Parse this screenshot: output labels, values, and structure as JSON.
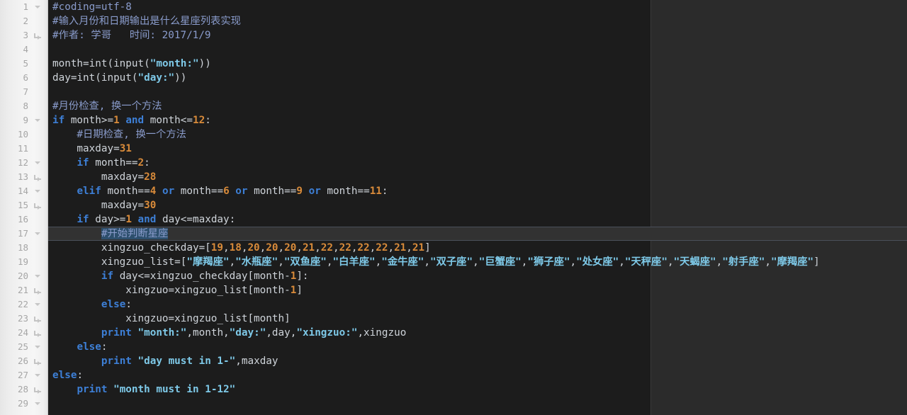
{
  "app": {
    "kind": "code-editor",
    "theme": "dark",
    "language": "Python",
    "colors": {
      "editor_background": "#1c1c1c",
      "panel_background": "#2b2b2b",
      "gutter_background": "#f2f2f2",
      "line_number": "#a6a6a6",
      "default_text": "#a9b7c6",
      "comment": "#8a9ccc",
      "keyword": "#3d7fd6",
      "number": "#d98b3a",
      "string": "#7ec9e8",
      "active_line_background": "#323232",
      "selection": "#2d4f6d"
    },
    "active_line": 17,
    "total_visible_lines": 29
  },
  "gutter": {
    "line_numbers": [
      "1",
      "2",
      "3",
      "4",
      "5",
      "6",
      "7",
      "8",
      "9",
      "10",
      "11",
      "12",
      "13",
      "14",
      "15",
      "16",
      "17",
      "18",
      "19",
      "20",
      "21",
      "22",
      "23",
      "24",
      "25",
      "26",
      "27",
      "28",
      "29"
    ],
    "markers": {
      "fold_icon": "chevron-down-icon",
      "continuation_icon": "line-continuation-icon",
      "fold_lines": [
        1,
        9,
        12,
        14,
        17,
        20,
        22,
        25,
        27,
        29
      ],
      "continuation_lines": [
        3,
        13,
        15,
        21,
        23,
        24,
        26,
        28
      ]
    }
  },
  "code": {
    "lines": [
      {
        "n": 1,
        "tokens": [
          {
            "t": "com",
            "v": "#coding=utf-8"
          }
        ]
      },
      {
        "n": 2,
        "tokens": [
          {
            "t": "com",
            "v": "#输入月份和日期输出是什么星座列表实现"
          }
        ]
      },
      {
        "n": 3,
        "tokens": [
          {
            "t": "com",
            "v": "#作者: 学哥   时间: 2017/1/9"
          }
        ]
      },
      {
        "n": 4,
        "tokens": []
      },
      {
        "n": 5,
        "tokens": [
          {
            "t": "pl",
            "v": "month=int(input("
          },
          {
            "t": "str",
            "v": "\"month:\""
          },
          {
            "t": "pl",
            "v": "))"
          }
        ]
      },
      {
        "n": 6,
        "tokens": [
          {
            "t": "pl",
            "v": "day=int(input("
          },
          {
            "t": "str",
            "v": "\"day:\""
          },
          {
            "t": "pl",
            "v": "))"
          }
        ]
      },
      {
        "n": 7,
        "tokens": []
      },
      {
        "n": 8,
        "tokens": [
          {
            "t": "com",
            "v": "#月份检查, 换一个方法"
          }
        ]
      },
      {
        "n": 9,
        "tokens": [
          {
            "t": "kw",
            "v": "if"
          },
          {
            "t": "pl",
            "v": " month>="
          },
          {
            "t": "num",
            "v": "1"
          },
          {
            "t": "pl",
            "v": " "
          },
          {
            "t": "kw",
            "v": "and"
          },
          {
            "t": "pl",
            "v": " month<="
          },
          {
            "t": "num",
            "v": "12"
          },
          {
            "t": "pl",
            "v": ":"
          }
        ]
      },
      {
        "n": 10,
        "tokens": [
          {
            "t": "com",
            "v": "    #日期检查, 换一个方法"
          }
        ]
      },
      {
        "n": 11,
        "tokens": [
          {
            "t": "pl",
            "v": "    maxday="
          },
          {
            "t": "num",
            "v": "31"
          }
        ]
      },
      {
        "n": 12,
        "tokens": [
          {
            "t": "pl",
            "v": "    "
          },
          {
            "t": "kw",
            "v": "if"
          },
          {
            "t": "pl",
            "v": " month=="
          },
          {
            "t": "num",
            "v": "2"
          },
          {
            "t": "pl",
            "v": ":"
          }
        ]
      },
      {
        "n": 13,
        "tokens": [
          {
            "t": "pl",
            "v": "        maxday="
          },
          {
            "t": "num",
            "v": "28"
          }
        ]
      },
      {
        "n": 14,
        "tokens": [
          {
            "t": "pl",
            "v": "    "
          },
          {
            "t": "kw",
            "v": "elif"
          },
          {
            "t": "pl",
            "v": " month=="
          },
          {
            "t": "num",
            "v": "4"
          },
          {
            "t": "pl",
            "v": " "
          },
          {
            "t": "kw",
            "v": "or"
          },
          {
            "t": "pl",
            "v": " month=="
          },
          {
            "t": "num",
            "v": "6"
          },
          {
            "t": "pl",
            "v": " "
          },
          {
            "t": "kw",
            "v": "or"
          },
          {
            "t": "pl",
            "v": " month=="
          },
          {
            "t": "num",
            "v": "9"
          },
          {
            "t": "pl",
            "v": " "
          },
          {
            "t": "kw",
            "v": "or"
          },
          {
            "t": "pl",
            "v": " month=="
          },
          {
            "t": "num",
            "v": "11"
          },
          {
            "t": "pl",
            "v": ":"
          }
        ]
      },
      {
        "n": 15,
        "tokens": [
          {
            "t": "pl",
            "v": "        maxday="
          },
          {
            "t": "num",
            "v": "30"
          }
        ]
      },
      {
        "n": 16,
        "tokens": [
          {
            "t": "pl",
            "v": "    "
          },
          {
            "t": "kw",
            "v": "if"
          },
          {
            "t": "pl",
            "v": " day>="
          },
          {
            "t": "num",
            "v": "1"
          },
          {
            "t": "pl",
            "v": " "
          },
          {
            "t": "kw",
            "v": "and"
          },
          {
            "t": "pl",
            "v": " day<=maxday:"
          }
        ]
      },
      {
        "n": 17,
        "tokens": [
          {
            "t": "pl",
            "v": "        "
          },
          {
            "t": "com-sel",
            "v": "#开始判断星座"
          }
        ]
      },
      {
        "n": 18,
        "tokens": [
          {
            "t": "pl",
            "v": "        xingzuo_checkday=["
          },
          {
            "t": "num",
            "v": "19"
          },
          {
            "t": "pl",
            "v": ","
          },
          {
            "t": "num",
            "v": "18"
          },
          {
            "t": "pl",
            "v": ","
          },
          {
            "t": "num",
            "v": "20"
          },
          {
            "t": "pl",
            "v": ","
          },
          {
            "t": "num",
            "v": "20"
          },
          {
            "t": "pl",
            "v": ","
          },
          {
            "t": "num",
            "v": "20"
          },
          {
            "t": "pl",
            "v": ","
          },
          {
            "t": "num",
            "v": "21"
          },
          {
            "t": "pl",
            "v": ","
          },
          {
            "t": "num",
            "v": "22"
          },
          {
            "t": "pl",
            "v": ","
          },
          {
            "t": "num",
            "v": "22"
          },
          {
            "t": "pl",
            "v": ","
          },
          {
            "t": "num",
            "v": "22"
          },
          {
            "t": "pl",
            "v": ","
          },
          {
            "t": "num",
            "v": "22"
          },
          {
            "t": "pl",
            "v": ","
          },
          {
            "t": "num",
            "v": "21"
          },
          {
            "t": "pl",
            "v": ","
          },
          {
            "t": "num",
            "v": "21"
          },
          {
            "t": "pl",
            "v": "]"
          }
        ]
      },
      {
        "n": 19,
        "tokens": [
          {
            "t": "pl",
            "v": "        xingzuo_list=["
          },
          {
            "t": "str",
            "v": "\"摩羯座\""
          },
          {
            "t": "pl",
            "v": ","
          },
          {
            "t": "str",
            "v": "\"水瓶座\""
          },
          {
            "t": "pl",
            "v": ","
          },
          {
            "t": "str",
            "v": "\"双鱼座\""
          },
          {
            "t": "pl",
            "v": ","
          },
          {
            "t": "str",
            "v": "\"白羊座\""
          },
          {
            "t": "pl",
            "v": ","
          },
          {
            "t": "str",
            "v": "\"金牛座\""
          },
          {
            "t": "pl",
            "v": ","
          },
          {
            "t": "str",
            "v": "\"双子座\""
          },
          {
            "t": "pl",
            "v": ","
          },
          {
            "t": "str",
            "v": "\"巨蟹座\""
          },
          {
            "t": "pl",
            "v": ","
          },
          {
            "t": "str",
            "v": "\"狮子座\""
          },
          {
            "t": "pl",
            "v": ","
          },
          {
            "t": "str",
            "v": "\"处女座\""
          },
          {
            "t": "pl",
            "v": ","
          },
          {
            "t": "str",
            "v": "\"天秤座\""
          },
          {
            "t": "pl",
            "v": ","
          },
          {
            "t": "str",
            "v": "\"天蝎座\""
          },
          {
            "t": "pl",
            "v": ","
          },
          {
            "t": "str",
            "v": "\"射手座\""
          },
          {
            "t": "pl",
            "v": ","
          },
          {
            "t": "str",
            "v": "\"摩羯座\""
          },
          {
            "t": "pl",
            "v": "]"
          }
        ]
      },
      {
        "n": 20,
        "tokens": [
          {
            "t": "pl",
            "v": "        "
          },
          {
            "t": "kw",
            "v": "if"
          },
          {
            "t": "pl",
            "v": " day<=xingzuo_checkday[month-"
          },
          {
            "t": "num",
            "v": "1"
          },
          {
            "t": "pl",
            "v": "]:"
          }
        ]
      },
      {
        "n": 21,
        "tokens": [
          {
            "t": "pl",
            "v": "            xingzuo=xingzuo_list[month-"
          },
          {
            "t": "num",
            "v": "1"
          },
          {
            "t": "pl",
            "v": "]"
          }
        ]
      },
      {
        "n": 22,
        "tokens": [
          {
            "t": "pl",
            "v": "        "
          },
          {
            "t": "kw",
            "v": "else"
          },
          {
            "t": "pl",
            "v": ":"
          }
        ]
      },
      {
        "n": 23,
        "tokens": [
          {
            "t": "pl",
            "v": "            xingzuo=xingzuo_list[month]"
          }
        ]
      },
      {
        "n": 24,
        "tokens": [
          {
            "t": "pl",
            "v": "        "
          },
          {
            "t": "kw",
            "v": "print"
          },
          {
            "t": "pl",
            "v": " "
          },
          {
            "t": "str",
            "v": "\"month:\""
          },
          {
            "t": "pl",
            "v": ",month,"
          },
          {
            "t": "str",
            "v": "\"day:\""
          },
          {
            "t": "pl",
            "v": ",day,"
          },
          {
            "t": "str",
            "v": "\"xingzuo:\""
          },
          {
            "t": "pl",
            "v": ",xingzuo"
          }
        ]
      },
      {
        "n": 25,
        "tokens": [
          {
            "t": "pl",
            "v": "    "
          },
          {
            "t": "kw",
            "v": "else"
          },
          {
            "t": "pl",
            "v": ":"
          }
        ]
      },
      {
        "n": 26,
        "tokens": [
          {
            "t": "pl",
            "v": "        "
          },
          {
            "t": "kw",
            "v": "print"
          },
          {
            "t": "pl",
            "v": " "
          },
          {
            "t": "str",
            "v": "\"day must in 1-\""
          },
          {
            "t": "pl",
            "v": ",maxday"
          }
        ]
      },
      {
        "n": 27,
        "tokens": [
          {
            "t": "kw",
            "v": "else"
          },
          {
            "t": "pl",
            "v": ":"
          }
        ]
      },
      {
        "n": 28,
        "tokens": [
          {
            "t": "pl",
            "v": "    "
          },
          {
            "t": "kw",
            "v": "print"
          },
          {
            "t": "pl",
            "v": " "
          },
          {
            "t": "str",
            "v": "\"month must in 1-12\""
          }
        ]
      },
      {
        "n": 29,
        "tokens": []
      }
    ]
  }
}
